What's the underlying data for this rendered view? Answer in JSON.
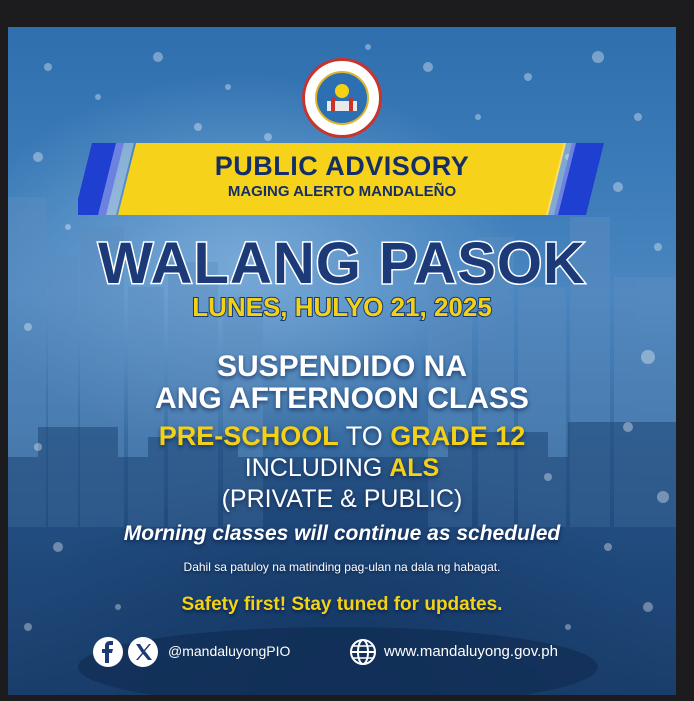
{
  "advisory": {
    "title": "PUBLIC ADVISORY",
    "subtitle": "MAGING ALERTO MANDALEÑO"
  },
  "seal": {
    "name": "UNGSOD MANDALUYONG",
    "colors": {
      "ring": "#c8332c",
      "center": "#2d6fb3",
      "gold": "#e0b52a"
    }
  },
  "headline": "WALANG PASOK",
  "date": "LUNES, HULYO 21, 2025",
  "suspension": {
    "line1": "SUSPENDIDO NA",
    "line2": "ANG AFTERNOON CLASS"
  },
  "grades": {
    "from": "PRE-SCHOOL",
    "connector": "TO",
    "to": "GRADE 12"
  },
  "including": {
    "prefix": "INCLUDING",
    "program": "ALS"
  },
  "coverage": "(PRIVATE & PUBLIC)",
  "morning_note": "Morning classes will continue as scheduled",
  "reason": "Dahil sa patuloy na matinding pag-ulan na dala ng habagat.",
  "safety": "Safety first! Stay tuned for updates.",
  "social": {
    "handle": "@mandaluyongPIO",
    "website": "www.mandaluyong.gov.ph",
    "icons": [
      "facebook-icon",
      "x-icon",
      "globe-icon"
    ]
  },
  "colors": {
    "navy": "#152f66",
    "yellow": "#f5d116",
    "banner_blue": "#1f3fd0",
    "banner_yellow": "#f7d21a"
  }
}
